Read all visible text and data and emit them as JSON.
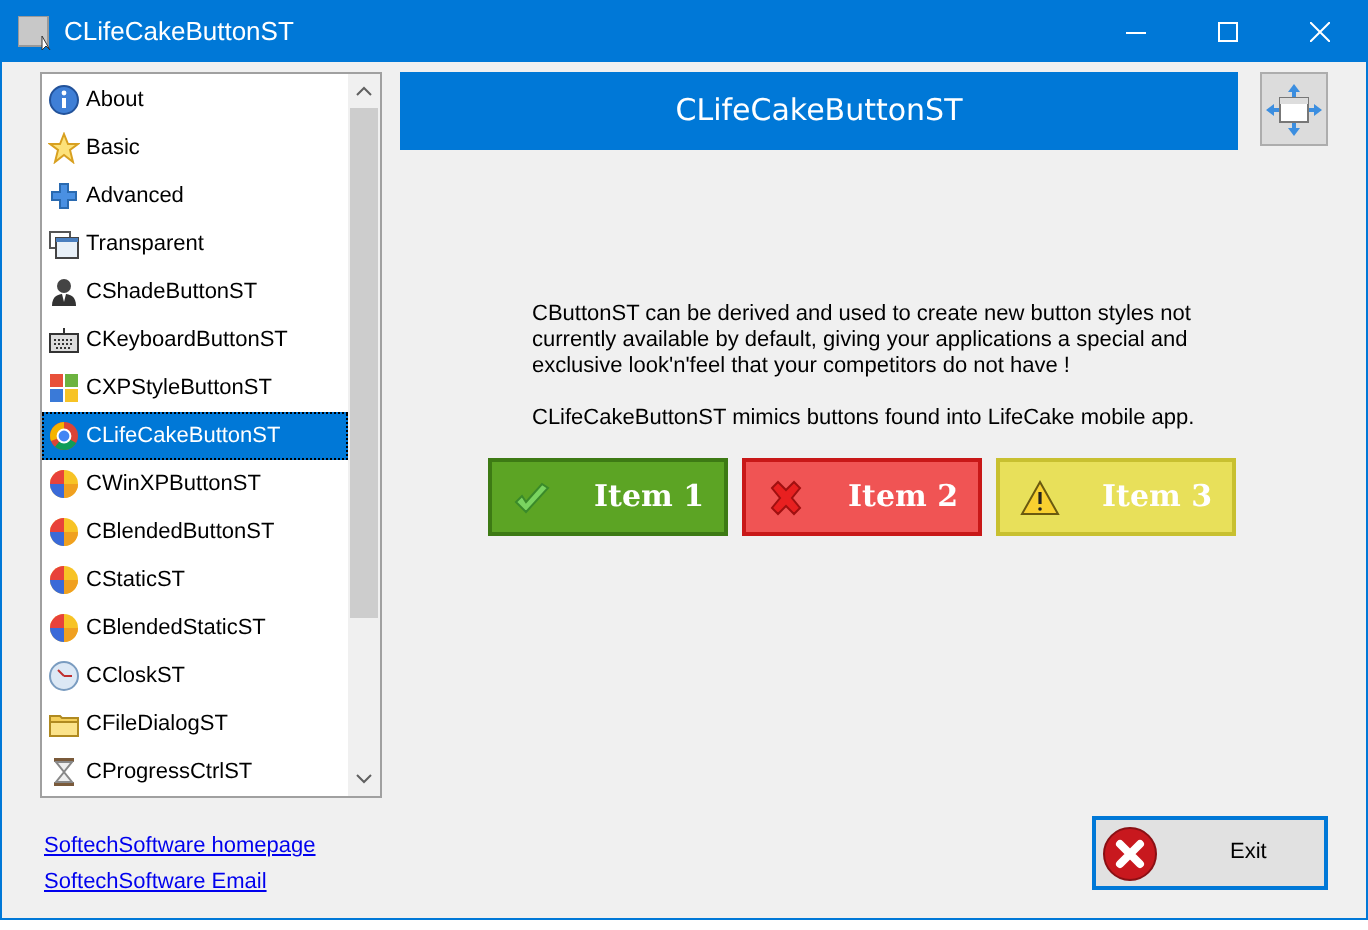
{
  "window": {
    "title": "CLifeCakeButtonST"
  },
  "list": {
    "items": [
      {
        "label": "About",
        "selected": false
      },
      {
        "label": "Basic",
        "selected": false
      },
      {
        "label": "Advanced",
        "selected": false
      },
      {
        "label": "Transparent",
        "selected": false
      },
      {
        "label": "CShadeButtonST",
        "selected": false
      },
      {
        "label": "CKeyboardButtonST",
        "selected": false
      },
      {
        "label": "CXPStyleButtonST",
        "selected": false
      },
      {
        "label": "CLifeCakeButtonST",
        "selected": true
      },
      {
        "label": "CWinXPButtonST",
        "selected": false
      },
      {
        "label": "CBlendedButtonST",
        "selected": false
      },
      {
        "label": "CStaticST",
        "selected": false
      },
      {
        "label": "CBlendedStaticST",
        "selected": false
      },
      {
        "label": "CCloskST",
        "selected": false
      },
      {
        "label": "CFileDialogST",
        "selected": false
      },
      {
        "label": "CProgressCtrlST",
        "selected": false
      }
    ]
  },
  "links": [
    "SoftechSoftware homepage",
    "SoftechSoftware Email"
  ],
  "header": "CLifeCakeButtonST",
  "description": [
    "CButtonST can be derived and used to create new button styles not currently available by default, giving your applications a special and exclusive look'n'feel that your competitors do not have !",
    "CLifeCakeButtonST mimics buttons found into LifeCake mobile app."
  ],
  "demo_buttons": [
    {
      "label": "Item 1",
      "kind": "success"
    },
    {
      "label": "Item 2",
      "kind": "error"
    },
    {
      "label": "Item 3",
      "kind": "warning"
    }
  ],
  "exit_button": "Exit"
}
